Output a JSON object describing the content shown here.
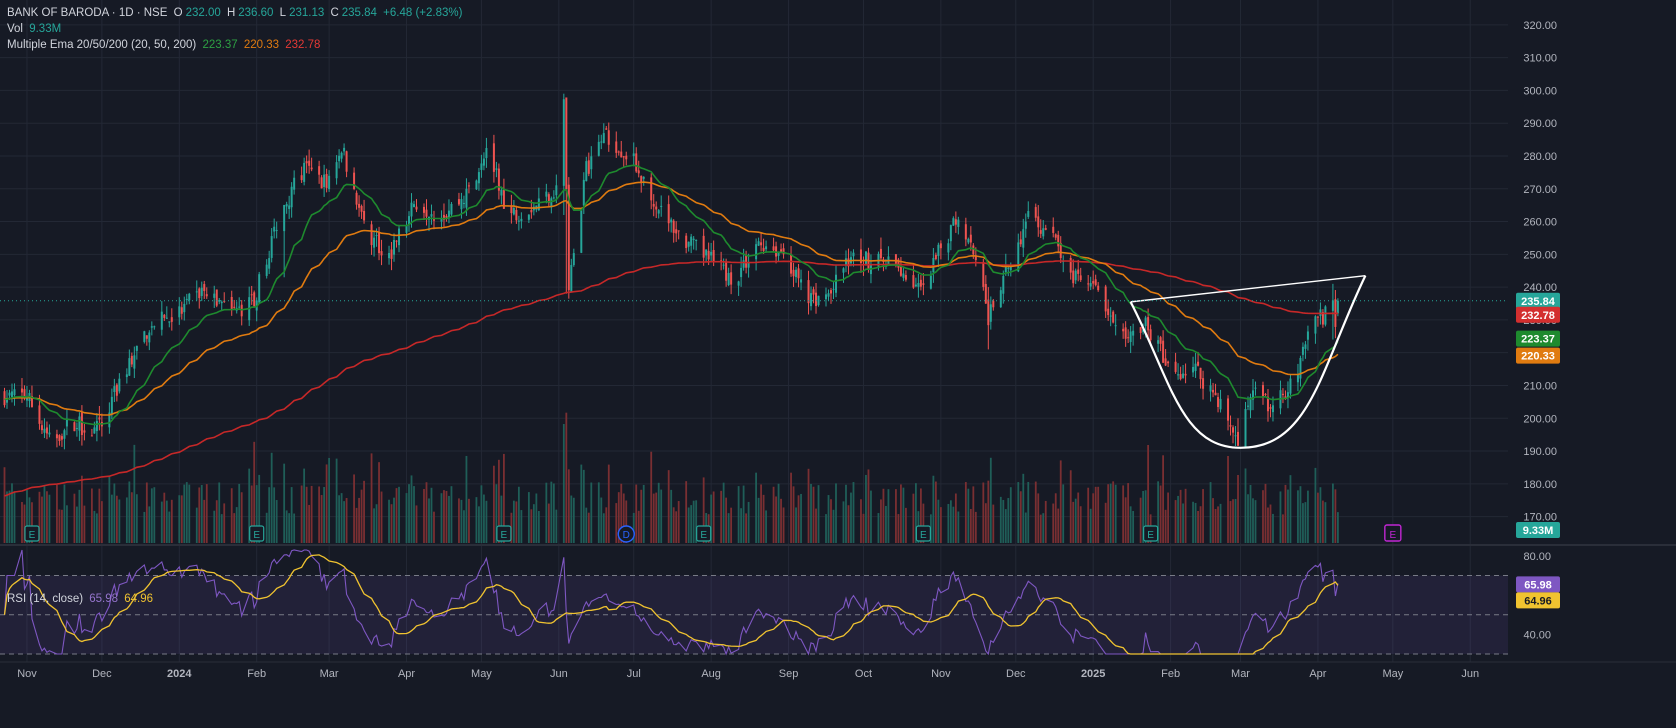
{
  "header": {
    "symbol": "BANK OF BARODA · 1D · NSE",
    "open_label": "O",
    "open": "232.00",
    "high_label": "H",
    "high": "236.60",
    "low_label": "L",
    "low": "231.13",
    "close_label": "C",
    "close": "235.84",
    "change": "+6.48 (+2.83%)",
    "vol_label": "Vol",
    "vol": "9.33M",
    "ema_label": "Multiple Ema 20/50/200 (20, 50, 200)",
    "ema20": "223.37",
    "ema50": "220.33",
    "ema200": "232.78",
    "rsi_label": "RSI (14, close)",
    "rsi": "65.98",
    "rsi_ma": "64.96"
  },
  "colors": {
    "background": "#161a25",
    "grid": "#232835",
    "up": "#26a69a",
    "down": "#ef5350",
    "ema20": "#1e8a2e",
    "ema50": "#e07b10",
    "ema200": "#c62828",
    "rsi": "#7e57c2",
    "rsi_ma": "#f0c330",
    "text": "#b2b5be"
  },
  "badges": {
    "last_price": "235.84",
    "ema200": "232.78",
    "ema20": "223.37",
    "ema50": "220.33",
    "volume": "9.33M",
    "rsi": "65.98",
    "rsi_ma": "64.96"
  },
  "chart_data": [
    {
      "type": "candlestick",
      "title": "BANK OF BARODA · 1D · NSE",
      "x_ticks": [
        "Nov",
        "Dec",
        "2024",
        "Feb",
        "Mar",
        "Apr",
        "May",
        "Jun",
        "Jul",
        "Aug",
        "Sep",
        "Oct",
        "Nov",
        "Dec",
        "2025",
        "Feb",
        "Mar",
        "Apr",
        "May",
        "Jun"
      ],
      "y_ticks": [
        170,
        180,
        190,
        200,
        210,
        220,
        230,
        240,
        250,
        260,
        270,
        280,
        290,
        300,
        310,
        320
      ],
      "ylim": [
        165,
        323
      ],
      "price_path": [
        {
          "date": "2023-11-01",
          "close": 207
        },
        {
          "date": "2023-11-10",
          "close": 193
        },
        {
          "date": "2023-11-20",
          "close": 199
        },
        {
          "date": "2023-11-28",
          "close": 196
        },
        {
          "date": "2023-12-01",
          "close": 198
        },
        {
          "date": "2023-12-10",
          "close": 214
        },
        {
          "date": "2023-12-20",
          "close": 228
        },
        {
          "date": "2024-01-01",
          "close": 232
        },
        {
          "date": "2024-01-10",
          "close": 239
        },
        {
          "date": "2024-01-22",
          "close": 232
        },
        {
          "date": "2024-01-31",
          "close": 236
        },
        {
          "date": "2024-02-10",
          "close": 262
        },
        {
          "date": "2024-02-20",
          "close": 276
        },
        {
          "date": "2024-02-29",
          "close": 272
        },
        {
          "date": "2024-03-06",
          "close": 283
        },
        {
          "date": "2024-03-15",
          "close": 258
        },
        {
          "date": "2024-03-25",
          "close": 250
        },
        {
          "date": "2024-04-05",
          "close": 266
        },
        {
          "date": "2024-04-15",
          "close": 262
        },
        {
          "date": "2024-04-25",
          "close": 268
        },
        {
          "date": "2024-05-03",
          "close": 283
        },
        {
          "date": "2024-05-12",
          "close": 262
        },
        {
          "date": "2024-05-22",
          "close": 265
        },
        {
          "date": "2024-05-31",
          "close": 270
        },
        {
          "date": "2024-06-03",
          "close": 298
        },
        {
          "date": "2024-06-05",
          "close": 240
        },
        {
          "date": "2024-06-12",
          "close": 276
        },
        {
          "date": "2024-06-20",
          "close": 287
        },
        {
          "date": "2024-07-01",
          "close": 278
        },
        {
          "date": "2024-07-10",
          "close": 266
        },
        {
          "date": "2024-07-20",
          "close": 255
        },
        {
          "date": "2024-08-01",
          "close": 248
        },
        {
          "date": "2024-08-10",
          "close": 242
        },
        {
          "date": "2024-08-20",
          "close": 254
        },
        {
          "date": "2024-08-31",
          "close": 250
        },
        {
          "date": "2024-09-08",
          "close": 236
        },
        {
          "date": "2024-09-18",
          "close": 238
        },
        {
          "date": "2024-09-26",
          "close": 250
        },
        {
          "date": "2024-10-05",
          "close": 248
        },
        {
          "date": "2024-10-15",
          "close": 246
        },
        {
          "date": "2024-10-25",
          "close": 238
        },
        {
          "date": "2024-11-01",
          "close": 252
        },
        {
          "date": "2024-11-08",
          "close": 262
        },
        {
          "date": "2024-11-15",
          "close": 250
        },
        {
          "date": "2024-11-20",
          "close": 230
        },
        {
          "date": "2024-11-28",
          "close": 246
        },
        {
          "date": "2024-12-06",
          "close": 262
        },
        {
          "date": "2024-12-15",
          "close": 256
        },
        {
          "date": "2024-12-24",
          "close": 243
        },
        {
          "date": "2025-01-03",
          "close": 238
        },
        {
          "date": "2025-01-12",
          "close": 224
        },
        {
          "date": "2025-01-22",
          "close": 230
        },
        {
          "date": "2025-02-01",
          "close": 213
        },
        {
          "date": "2025-02-10",
          "close": 216
        },
        {
          "date": "2025-02-20",
          "close": 206
        },
        {
          "date": "2025-02-28",
          "close": 193
        },
        {
          "date": "2025-03-06",
          "close": 208
        },
        {
          "date": "2025-03-14",
          "close": 203
        },
        {
          "date": "2025-03-22",
          "close": 211
        },
        {
          "date": "2025-03-28",
          "close": 226
        },
        {
          "date": "2025-04-04",
          "close": 232
        },
        {
          "date": "2025-04-06",
          "close": 239
        },
        {
          "date": "2025-04-08",
          "close": 230
        },
        {
          "date": "2025-04-09",
          "close": 235.84
        }
      ],
      "series": [
        {
          "name": "EMA 20",
          "last": 223.37
        },
        {
          "name": "EMA 50",
          "last": 220.33
        },
        {
          "name": "EMA 200",
          "last": 232.78
        }
      ],
      "annotations": [
        "cup pattern drawn from Jan 2025 to Apr 2025 with rim line"
      ]
    },
    {
      "type": "line",
      "title": "RSI (14, close)",
      "y_ticks": [
        40,
        80
      ],
      "ylim": [
        29,
        84
      ],
      "bands": [
        70,
        50,
        30
      ],
      "series": [
        {
          "name": "RSI",
          "last": 65.98
        },
        {
          "name": "RSI MA",
          "last": 64.96
        }
      ]
    }
  ]
}
